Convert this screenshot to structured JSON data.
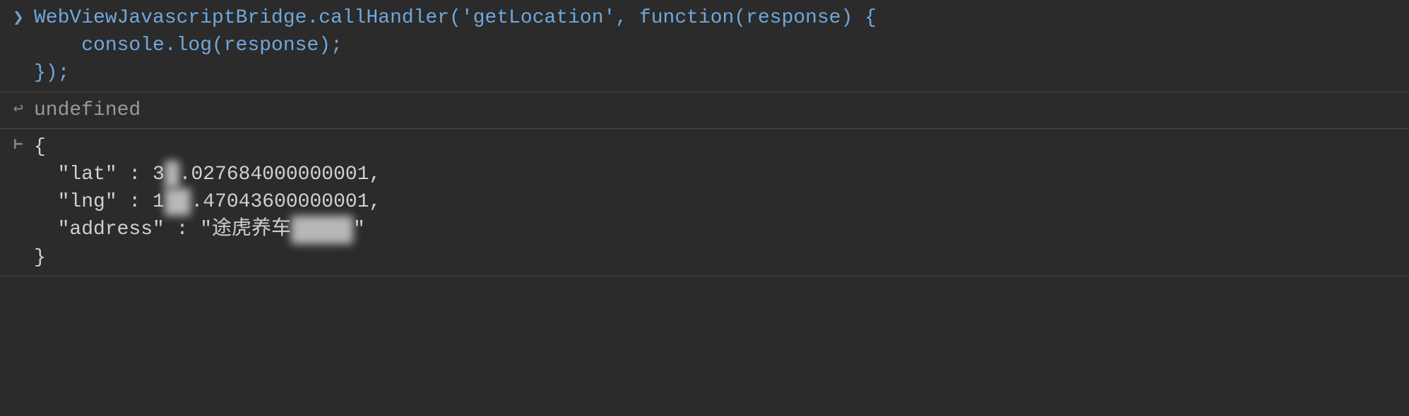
{
  "console": {
    "input": {
      "line1": "WebViewJavascriptBridge.callHandler('getLocation', function(response) {",
      "line2": "    console.log(response);",
      "line3": "});"
    },
    "return_value": "undefined",
    "log": {
      "open_brace": "{",
      "lat_key": "  \"lat\" : 3",
      "lat_blur": "1",
      "lat_rest": ".027684000000001,",
      "lng_key": "  \"lng\" : 1",
      "lng_blur": "21",
      "lng_rest": ".47043600000001,",
      "address_key": "  \"address\" : \"途虎养车",
      "address_blur": "玛莎拉",
      "address_rest": "\"",
      "close_brace": "}"
    }
  }
}
